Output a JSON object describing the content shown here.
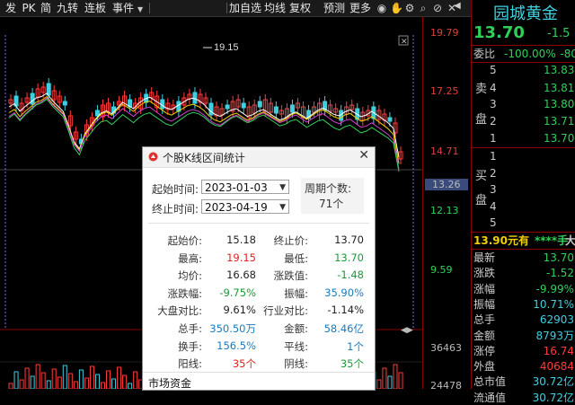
{
  "toolbar": {
    "left_items": [
      "发",
      "PK",
      "简",
      "九转",
      "连板",
      "事件"
    ],
    "right_items": [
      "加自选",
      "均线",
      "复权",
      "预测",
      "更多"
    ],
    "icons": [
      "eye-icon",
      "hand-icon",
      "gear-icon",
      "search-icon",
      "ban-icon",
      "close-icon"
    ]
  },
  "chart": {
    "high_marker": "19.15",
    "price_labels": [
      {
        "value": "19.79",
        "color": "red"
      },
      {
        "value": "17.25",
        "color": "red"
      },
      {
        "value": "14.71",
        "color": "red"
      },
      {
        "value": "13.26",
        "color": "white"
      },
      {
        "value": "12.13",
        "color": "green"
      },
      {
        "value": "9.59",
        "color": "green"
      }
    ],
    "volume_labels": [
      "36463",
      "24478"
    ]
  },
  "quote": {
    "name": "园城黄金",
    "price": "13.70",
    "change_head": "-1.5",
    "weibi_label": "委比",
    "weibi_value": "-100.00%",
    "weibi_value2": "-80",
    "sell_rows": [
      {
        "level": "5",
        "price": "13.83"
      },
      {
        "level": "4",
        "price": "13.81"
      },
      {
        "level": "3",
        "price": "13.80"
      },
      {
        "level": "2",
        "price": "13.71"
      },
      {
        "level": "1",
        "price": "13.70"
      }
    ],
    "sell_label": [
      "卖",
      "盘"
    ],
    "buy_rows": [
      "1",
      "2",
      "3",
      "4",
      "5"
    ],
    "buy_label": [
      "买",
      "盘"
    ],
    "trade_line": "13.90元有",
    "trade_stars": "****手",
    "trade_end": "大",
    "stats": [
      {
        "label": "最新",
        "value": "13.70",
        "color": "green"
      },
      {
        "label": "涨跌",
        "value": "-1.52",
        "color": "green"
      },
      {
        "label": "涨幅",
        "value": "-9.99%",
        "color": "green"
      },
      {
        "label": "振幅",
        "value": "10.71%",
        "color": "cyan"
      },
      {
        "label": "总手",
        "value": "62903",
        "color": "cyan"
      },
      {
        "label": "金额",
        "value": "8793万",
        "color": "cyan"
      },
      {
        "label": "涨停",
        "value": "16.74",
        "color": "red"
      },
      {
        "label": "外盘",
        "value": "40684",
        "color": "red"
      },
      {
        "label": "总市值",
        "value": "30.72亿",
        "color": "cyan"
      },
      {
        "label": "流通值",
        "value": "30.72亿",
        "color": "cyan"
      }
    ]
  },
  "dialog": {
    "title": "个股K线区间统计",
    "start_label": "起始时间:",
    "start_value": "2023-01-03",
    "end_label": "终止时间:",
    "end_value": "2023-04-19",
    "period_label": "周期个数:",
    "period_value": "71个",
    "stats": [
      {
        "lk": "起始价:",
        "lv": "15.18",
        "lc": "k",
        "rk": "终止价:",
        "rv": "13.70",
        "rc": "k"
      },
      {
        "lk": "最高:",
        "lv": "19.15",
        "lc": "r",
        "rk": "最低:",
        "rv": "13.70",
        "rc": "g"
      },
      {
        "lk": "均价:",
        "lv": "16.68",
        "lc": "k",
        "rk": "涨跌值:",
        "rv": "-1.48",
        "rc": "g"
      },
      {
        "lk": "涨跌幅:",
        "lv": "-9.75%",
        "lc": "g",
        "rk": "振幅:",
        "rv": "35.90%",
        "rc": "b"
      },
      {
        "lk": "大盘对比:",
        "lv": "9.61%",
        "lc": "k",
        "rk": "行业对比:",
        "rv": "-1.14%",
        "rc": "k"
      },
      {
        "lk": "总手:",
        "lv": "350.50万",
        "lc": "b",
        "rk": "金额:",
        "rv": "58.46亿",
        "rc": "b"
      },
      {
        "lk": "换手:",
        "lv": "156.5%",
        "lc": "b",
        "rk": "平线:",
        "rv": "1个",
        "rc": "b"
      },
      {
        "lk": "阳线:",
        "lv": "35个",
        "lc": "r",
        "rk": "阴线:",
        "rv": "35个",
        "rc": "g"
      }
    ],
    "market_label": "市场资金"
  }
}
